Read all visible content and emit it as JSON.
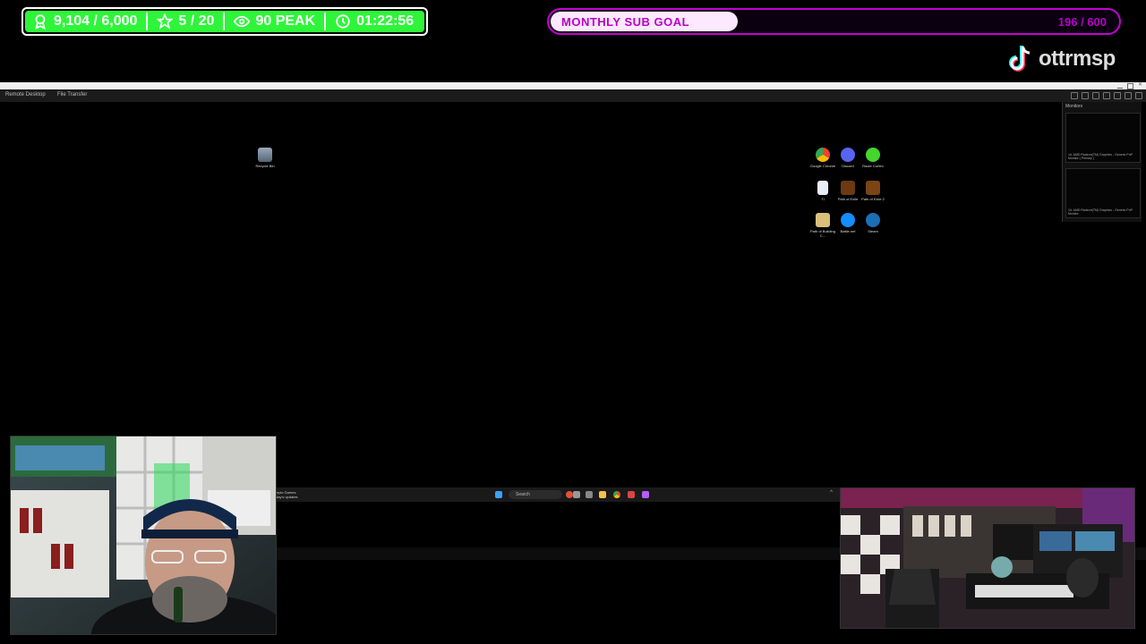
{
  "stats": {
    "followers": "9,104 / 6,000",
    "stars": "5 / 20",
    "viewers": "90 PEAK",
    "timer": "01:22:56",
    "accent": "#2ef53a"
  },
  "sub_goal": {
    "label": "MONTHLY SUB GOAL",
    "count": "196 / 600",
    "progress": 0.33,
    "color": "#c400d0"
  },
  "tiktok": {
    "handle": "ottrmsp",
    "icon": "tiktok-icon"
  },
  "remote_window": {
    "toolbar": {
      "tab_remote": "Remote Desktop",
      "tab_file": "File Transfer"
    },
    "desktop_icons": [
      {
        "label": "Recycle Bin",
        "icon": "recycle-bin-icon"
      },
      {
        "label": "Google Chrome",
        "icon": "chrome-icon"
      },
      {
        "label": "Discord",
        "icon": "discord-icon"
      },
      {
        "label": "Razer Cortex",
        "icon": "razer-cortex-icon"
      },
      {
        "label": "TI",
        "icon": "file-icon"
      },
      {
        "label": "Path of Exile",
        "icon": "poe-icon"
      },
      {
        "label": "Path of Exile 2",
        "icon": "poe2-icon"
      },
      {
        "label": "Path of Building C...",
        "icon": "pob-icon"
      },
      {
        "label": "Battle.net",
        "icon": "battlenet-icon"
      },
      {
        "label": "Steam",
        "icon": "steam-icon"
      }
    ],
    "monitors": {
      "header": "Monitors",
      "items": [
        {
          "caption": "1#. AMD Radeon(TM) Graphics - Generic PnP Monitor ( Primary )"
        },
        {
          "caption": "1#. AMD Radeon(TM) Graphics - Generic PnP Monitor"
        }
      ]
    },
    "taskbar": {
      "notification_title": "mpic Games",
      "notification_sub": "day's updates",
      "search_label": "Search"
    }
  }
}
